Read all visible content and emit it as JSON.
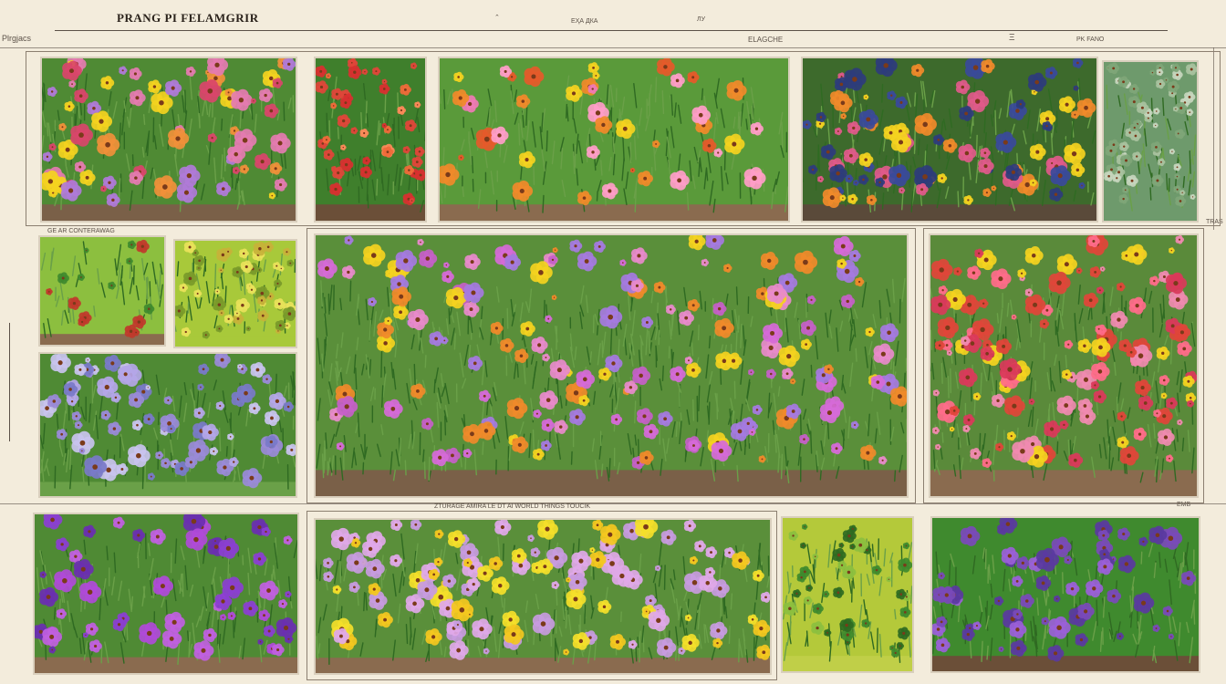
{
  "title": "PRANG  PI  FELAMGRIR",
  "marginalia": {
    "top_left": "Plrgjacs",
    "top_a": "⌃",
    "top_b": "ЕҲА  ДКА",
    "top_c": "ЛУ",
    "top_d": "ELAGCHE",
    "top_e": "Ξ",
    "top_f": "PK FANO",
    "mid_left": "GE  AR  CONTERAWAG",
    "mid_right": "TRAS",
    "bottom_mid": "ZTURAGE AMIRA  LE  DT  AI  WORLD  THINGS  TOUCIK",
    "bottom_right": "EMB"
  },
  "colors": {
    "paper": "#f3ecdc",
    "soil": "#8a6b4f",
    "leaf": "#3f8a2e",
    "leaf_light": "#8cbf3f",
    "pink": "#e47bb0",
    "red": "#e0453a",
    "orange": "#f08a2a",
    "yellow": "#f4d21f",
    "purple": "#8b3fd0",
    "lavender": "#a58bd8",
    "blue": "#3a4a9a"
  },
  "panels": [
    {
      "name": "pink-red-yellow-bed",
      "bg": "#4f8a34",
      "soil": "#7a6048",
      "mix": [
        "#e47bb0",
        "#d9456a",
        "#f0903a",
        "#f4d21f",
        "#b07ad8"
      ],
      "count": 70
    },
    {
      "name": "red-orange-flowers",
      "bg": "#3f7f2c",
      "soil": "#6b4f38",
      "mix": [
        "#e0453a",
        "#f06a3a",
        "#ff8a5a",
        "#d83030"
      ],
      "count": 45
    },
    {
      "name": "pink-orange-tall",
      "bg": "#5a9a3a",
      "soil": "#8a6b4f",
      "mix": [
        "#f07ab5",
        "#e55a2a",
        "#f08a2a",
        "#ff9dc8",
        "#f4d21f"
      ],
      "count": 40
    },
    {
      "name": "yellow-blue-bed",
      "bg": "#3d6a2c",
      "soil": "#5a4a3a",
      "mix": [
        "#f4d21f",
        "#f08a2a",
        "#e05a8a",
        "#3a4a9a",
        "#2e3c7c"
      ],
      "count": 90
    },
    {
      "name": "gray-green-groundcover",
      "bg": "#6e9a6c",
      "soil": "#6e9a6c",
      "mix": [
        "#a9c2a0",
        "#7fa678",
        "#c7d6be"
      ],
      "count": 60
    },
    {
      "name": "shrub",
      "bg": "#8cbf3f",
      "soil": "#8a6b4f",
      "mix": [
        "#c0392b",
        "#3f8a2e"
      ],
      "count": 15
    },
    {
      "name": "yellow-green-groundcover",
      "bg": "#a8c93a",
      "soil": "#a8c93a",
      "mix": [
        "#e9e25a",
        "#c7b23a",
        "#7a9a2a"
      ],
      "count": 50
    },
    {
      "name": "lavender-hedge",
      "bg": "#4f8a34",
      "soil": "#6aa048",
      "mix": [
        "#9a8ad8",
        "#b4a6e8",
        "#7a7ac8",
        "#c9c3ee"
      ],
      "count": 70
    },
    {
      "name": "pink-purple-meadow",
      "bg": "#5a8f3a",
      "soil": "#7a6048",
      "mix": [
        "#d66ad8",
        "#a57ae0",
        "#e88acb",
        "#c55fc8",
        "#f4d21f",
        "#f08a2a"
      ],
      "count": 160
    },
    {
      "name": "pink-red-field",
      "bg": "#5a8a3a",
      "soil": "#8a6b4f",
      "mix": [
        "#ff6b8a",
        "#e0453a",
        "#f08ab0",
        "#d93a5a",
        "#f4d21f"
      ],
      "count": 130
    },
    {
      "name": "purple-iris",
      "bg": "#4f8a34",
      "soil": "#8a6b4f",
      "mix": [
        "#8b3fd0",
        "#b04ad8",
        "#6a2fb0",
        "#c060e0"
      ],
      "count": 55
    },
    {
      "name": "yellow-mums",
      "bg": "#5a8f3a",
      "soil": "#8a6b4f",
      "mix": [
        "#f4e02a",
        "#f4c81f",
        "#c89be0",
        "#e0a8e8"
      ],
      "count": 120
    },
    {
      "name": "green-ball-shrub",
      "bg": "#b4c93a",
      "soil": "#c0cf48",
      "mix": [
        "#3f8a2e",
        "#2f6a22",
        "#8cbf3f"
      ],
      "count": 40
    },
    {
      "name": "violet-groundcover",
      "bg": "#3f8a2e",
      "soil": "#6b4f38",
      "mix": [
        "#7a4ab8",
        "#9a60d8",
        "#5a3aa0"
      ],
      "count": 60
    }
  ]
}
